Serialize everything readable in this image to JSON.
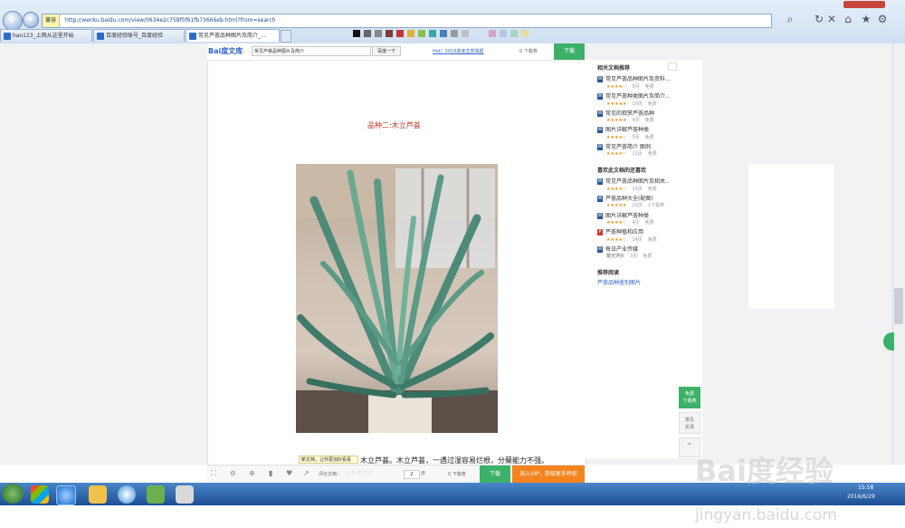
{
  "browser": {
    "address": "http://wenku.baidu.com/view/0634e2c758f5f61fb73666eb.html?from=search",
    "compat_mode": "兼容",
    "tabs": [
      {
        "label": "hao123_上网从这里开始"
      },
      {
        "label": "百度经验账号_百度经验"
      },
      {
        "label": "常见芦荟品种图片及简介_..."
      }
    ]
  },
  "wenku": {
    "logo": "Bai度文库",
    "search_value": "常见芦荟品种图片及简介",
    "search_button": "百度一下",
    "hot_link": "Hot！2016高考志愿填报",
    "points": "0 下载券",
    "download": "下载"
  },
  "document": {
    "heading": "品种二:木立芦荟",
    "caption": "木立芦荟。木立芦荟，一遇过湿容易烂根，分蘖能力不强。",
    "tooltip": "新文档，让你更加好看看"
  },
  "sidebar": {
    "related_title": "相关文档推荐",
    "related": [
      {
        "title": "常见芦荟品种图片及资料...",
        "stars": "★★★★☆",
        "pages": "9页",
        "price": "免费"
      },
      {
        "title": "常见芦荟种类图片及简介...",
        "stars": "★★★★★",
        "pages": "10页",
        "price": "免费"
      },
      {
        "title": "常见的观赏芦荟品种",
        "stars": "★★★★★",
        "pages": "4页",
        "price": "免费"
      },
      {
        "title": "图片详解芦荟种类",
        "stars": "★★★★☆",
        "pages": "5页",
        "price": "免费"
      },
      {
        "title": "常见芦荟简介 图例",
        "stars": "★★★★☆",
        "pages": "11页",
        "price": "免费"
      }
    ],
    "also_title": "喜欢此文档的还喜欢",
    "also": [
      {
        "title": "常见芦荟品种图片及相关...",
        "stars": "★★★★☆",
        "pages": "10页",
        "price": "免费",
        "icon": "W"
      },
      {
        "title": "芦荟品种大全(配图)",
        "stars": "★★★★★",
        "pages": "20页",
        "price": "1下载券",
        "icon": "W"
      },
      {
        "title": "图片详解芦荟种类",
        "stars": "★★★★☆",
        "pages": "9页",
        "price": "免费",
        "icon": "W"
      },
      {
        "title": "芦荟种植和应用",
        "stars": "★★★★☆",
        "pages": "14页",
        "price": "免费",
        "icon": "P"
      },
      {
        "title": "每日产业传媒",
        "stars": "暂无评价",
        "pages": "3页",
        "price": "免费",
        "icon": "W"
      }
    ],
    "recommend_title": "推荐阅读",
    "recommend_link": "芦荟品种鉴别图片"
  },
  "float_buttons": {
    "download_label": "免费\n下载券",
    "feedback_label": "意见\n反馈"
  },
  "bottom_toolbar": {
    "rate_label": "评价文档：",
    "stars": "☆☆☆☆☆",
    "page_current": "2",
    "page_total": "/8",
    "points": "0 下载券",
    "download": "下载",
    "vip": "加入VIP，获取更多特权"
  },
  "taskbar": {
    "time": "15:58",
    "date": "2016/6/29"
  },
  "watermark": {
    "text": "Bai度经验",
    "url": "jingyan.baidu.com"
  },
  "colors": {
    "baidu_blue": "#2e64c9",
    "wenku_green": "#3db169",
    "heading_red": "#c0392b",
    "vip_orange": "#f5841f",
    "star": "#f08c1a"
  }
}
